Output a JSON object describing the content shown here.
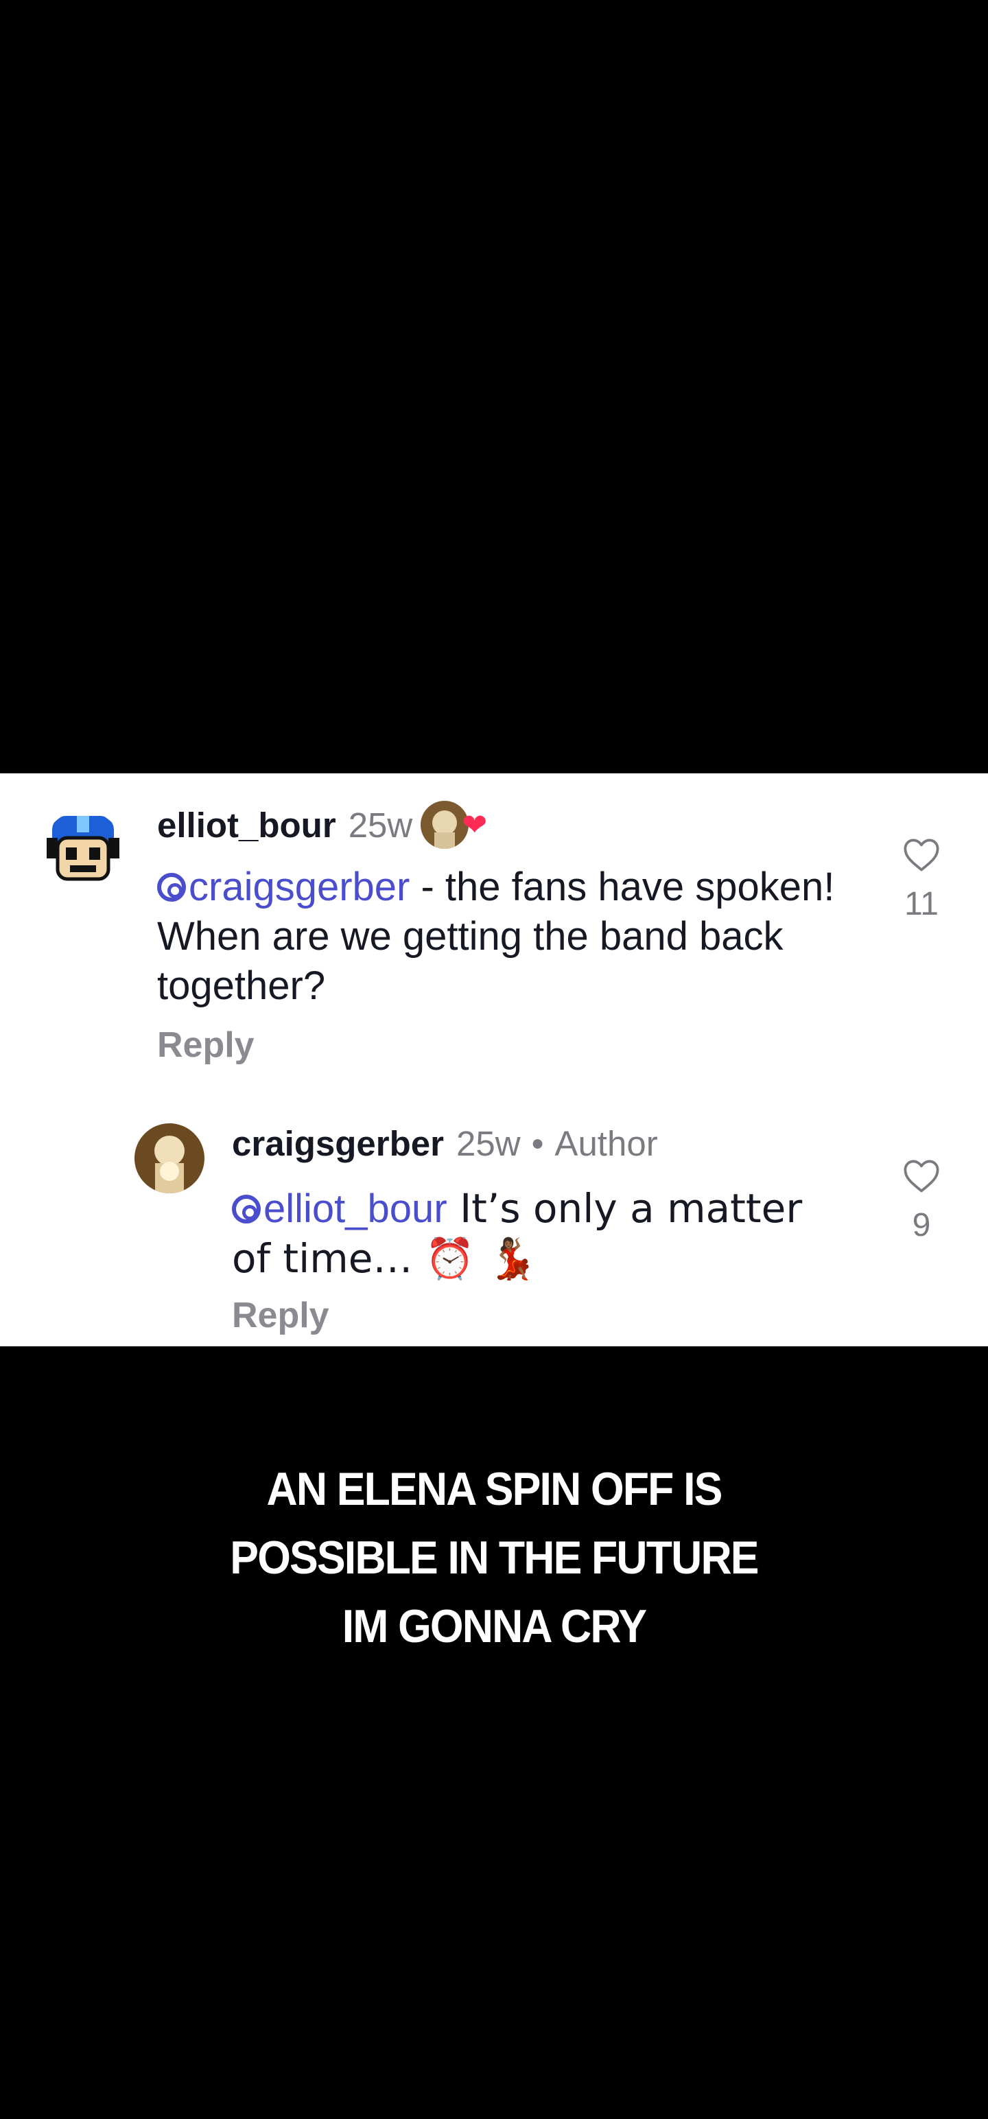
{
  "comments": [
    {
      "username": "elliot_bour",
      "time": "25w",
      "mention": "craigsgerber",
      "text": " - the fans have spoken! When are we getting the band back together?",
      "reply_label": "Reply",
      "likes": "11"
    },
    {
      "username": "craigsgerber",
      "time": "25w",
      "separator": "•",
      "author_label": "Author",
      "mention": "elliot_bour",
      "text": " It’s only a matter of time… ⏰ 💃🏾",
      "reply_label": "Reply",
      "likes": "9"
    }
  ],
  "caption": {
    "line1": "AN ELENA SPIN OFF IS",
    "line2": "POSSIBLE IN THE FUTURE",
    "line3": "IM GONNA CRY"
  },
  "colors": {
    "background": "#000000",
    "panel": "#ffffff",
    "mention": "#4a4dcc",
    "liked_heart": "#fe2c55"
  },
  "icons": [
    "threads-icon",
    "heart-outline-icon",
    "heart-filled-icon"
  ]
}
